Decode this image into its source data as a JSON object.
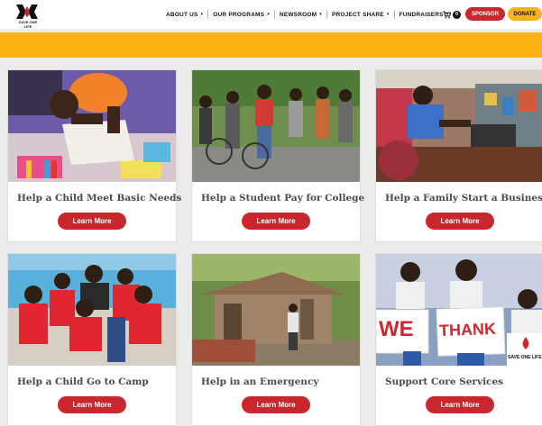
{
  "header": {
    "logo_text": "SAVE ONE LIFE",
    "nav": [
      {
        "label": "ABOUT US"
      },
      {
        "label": "OUR PROGRAMS"
      },
      {
        "label": "NEWSROOM"
      },
      {
        "label": "PROJECT SHARE"
      },
      {
        "label": "FUNDRAISERS"
      }
    ],
    "cart_count": "0",
    "sponsor_label": "SPONSOR",
    "donate_label": "DONATE"
  },
  "colors": {
    "brand_red": "#c8282d",
    "brand_yellow": "#fcb314"
  },
  "cards": [
    {
      "title": "Help a Child Meet Basic Needs",
      "button": "Learn More",
      "image": "child-drawing-photo"
    },
    {
      "title": "Help a Student Pay for College",
      "button": "Learn More",
      "image": "students-group-photo"
    },
    {
      "title": "Help a Family Start a Business",
      "button": "Learn More",
      "image": "repair-shop-photo"
    },
    {
      "title": "Help a Child Go to Camp",
      "button": "Learn More",
      "image": "kids-at-pool-photo"
    },
    {
      "title": "Help in an Emergency",
      "button": "Learn More",
      "image": "damaged-house-photo"
    },
    {
      "title": "Support Core Services",
      "button": "Learn More",
      "image": "we-thank-sign-photo"
    }
  ],
  "photo_signs": {
    "we": "WE",
    "thank": "THANK",
    "save_one_life": "SAVE ONE LIFE"
  }
}
